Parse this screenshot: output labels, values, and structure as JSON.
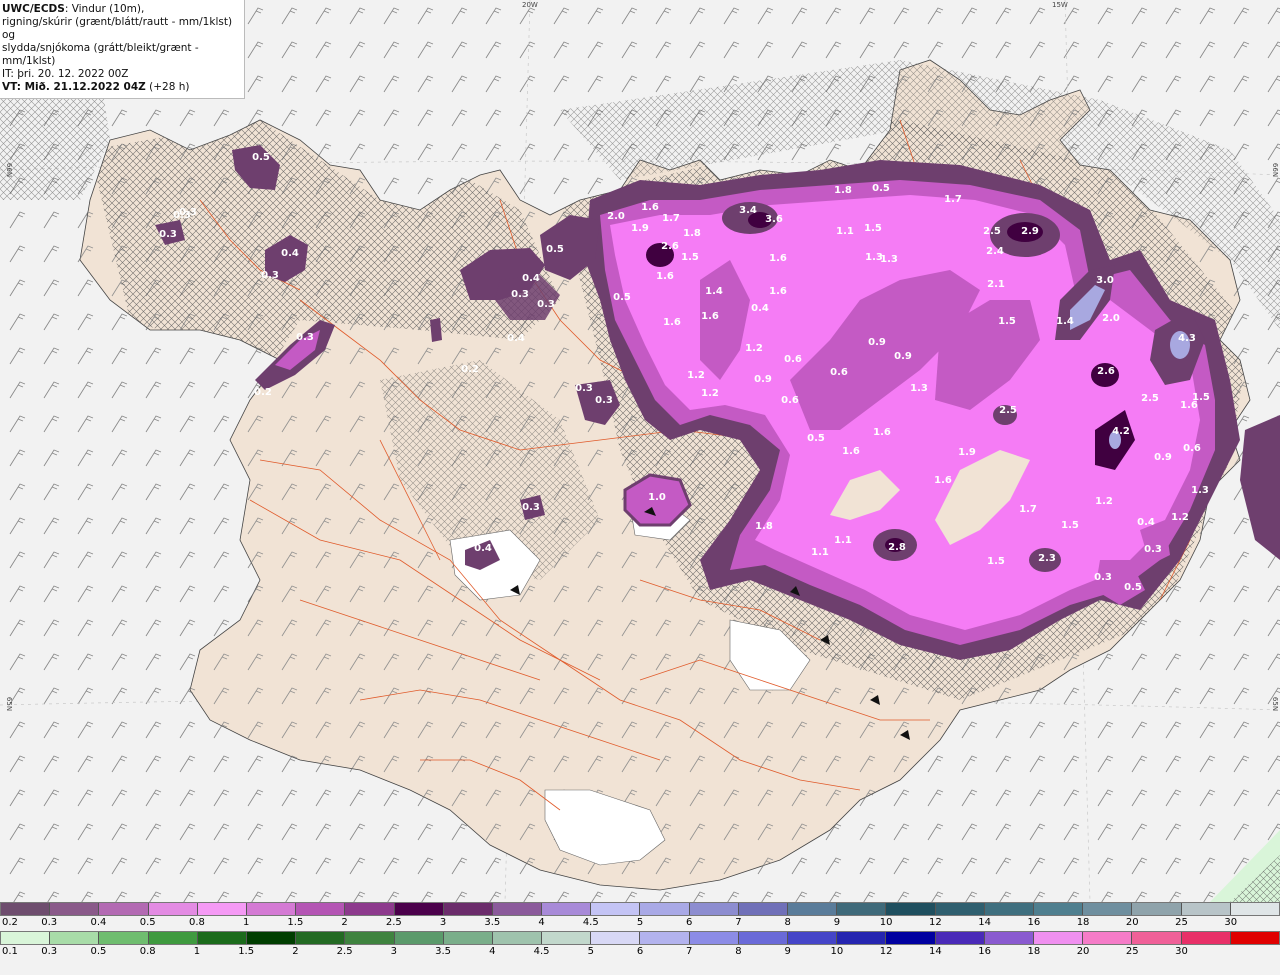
{
  "header": {
    "product": "UWC/ECDS",
    "line1_rest": ": Vindur (10m),",
    "line2": "rigning/skúrir (grænt/blátt/rautt - mm/1klst) og",
    "line3": "slydda/snjókoma (grátt/bleikt/grænt - mm/1klst)",
    "it_line": "IT: þri. 20. 12. 2022 00Z",
    "vt_bold": "VT: Mið. 21.12.2022 04Z",
    "vt_rest": " (+28 h)"
  },
  "coordinates": {
    "top_left": "20W",
    "top_right": "15W",
    "left_upper": "66N",
    "left_lower": "65N",
    "right_upper": "66N",
    "right_lower": "65N"
  },
  "colors": {
    "sea": "#f2f2f2",
    "land": "#f1e3d5",
    "road": "#e05a2a",
    "light_purple": "#e68ae6",
    "mid_purple": "#c45ac4",
    "magenta": "#f57cf5",
    "dark_purple": "#6e3f6e",
    "deep_purple": "#400040",
    "blue_lavender": "#a8a8e0"
  },
  "map_labels": [
    {
      "text": "0.5"
    },
    {
      "text": "0.3"
    },
    {
      "text": "0.4"
    },
    {
      "text": "0.3"
    },
    {
      "text": "0.3"
    },
    {
      "text": "0.2"
    },
    {
      "text": "0.3"
    },
    {
      "text": "0.3"
    },
    {
      "text": "0.3"
    },
    {
      "text": "0.4"
    },
    {
      "text": "0.4"
    },
    {
      "text": "0.3"
    },
    {
      "text": "0.3"
    },
    {
      "text": "0.5"
    },
    {
      "text": "2.0"
    },
    {
      "text": "1.9"
    },
    {
      "text": "1.6"
    },
    {
      "text": "1.7"
    },
    {
      "text": "1.8"
    },
    {
      "text": "2.6"
    },
    {
      "text": "1.5"
    },
    {
      "text": "1.6"
    },
    {
      "text": "1.4"
    },
    {
      "text": "1.6"
    },
    {
      "text": "1.6"
    },
    {
      "text": "0.5"
    },
    {
      "text": "3.4"
    },
    {
      "text": "3.6"
    },
    {
      "text": "1.6"
    },
    {
      "text": "1.8"
    },
    {
      "text": "0.5"
    },
    {
      "text": "1.1"
    },
    {
      "text": "1.5"
    },
    {
      "text": "1.3"
    },
    {
      "text": "1.3"
    },
    {
      "text": "1.7"
    },
    {
      "text": "2.5"
    },
    {
      "text": "2.9"
    },
    {
      "text": "2.4"
    },
    {
      "text": "2.1"
    },
    {
      "text": "1.6"
    },
    {
      "text": "0.4"
    },
    {
      "text": "1.2"
    },
    {
      "text": "0.6"
    },
    {
      "text": "1.2"
    },
    {
      "text": "0.9"
    },
    {
      "text": "1.2"
    },
    {
      "text": "0.6"
    },
    {
      "text": "0.9"
    },
    {
      "text": "0.9"
    },
    {
      "text": "0.6"
    },
    {
      "text": "1.3"
    },
    {
      "text": "1.5"
    },
    {
      "text": "3.0"
    },
    {
      "text": "2.0"
    },
    {
      "text": "1.4"
    },
    {
      "text": "4.3"
    },
    {
      "text": "2.6"
    },
    {
      "text": "2.5"
    },
    {
      "text": "1.6"
    },
    {
      "text": "1.5"
    },
    {
      "text": "2.5"
    },
    {
      "text": "0.5"
    },
    {
      "text": "1.6"
    },
    {
      "text": "1.6"
    },
    {
      "text": "1.9"
    },
    {
      "text": "1.6"
    },
    {
      "text": "4.2"
    },
    {
      "text": "0.9"
    },
    {
      "text": "0.6"
    },
    {
      "text": "1.0"
    },
    {
      "text": "1.3"
    },
    {
      "text": "1.2"
    },
    {
      "text": "1.7"
    },
    {
      "text": "1.5"
    },
    {
      "text": "1.2"
    },
    {
      "text": "0.4"
    },
    {
      "text": "1.8"
    },
    {
      "text": "1.1"
    },
    {
      "text": "1.1"
    },
    {
      "text": "2.8"
    },
    {
      "text": "1.5"
    },
    {
      "text": "2.3"
    },
    {
      "text": "0.3"
    },
    {
      "text": "0.5"
    },
    {
      "text": "0.3"
    },
    {
      "text": "0.4"
    },
    {
      "text": "0.3"
    },
    {
      "text": "0.2"
    },
    {
      "text": "0.3"
    }
  ],
  "scale_snow": {
    "ticks": [
      "0.2",
      "0.3",
      "0.4",
      "0.5",
      "0.8",
      "1",
      "1.5",
      "2",
      "2.5",
      "3",
      "3.5",
      "4",
      "4.5",
      "5",
      "6",
      "7",
      "8",
      "9",
      "10",
      "12",
      "14",
      "16",
      "18",
      "20",
      "25",
      "30"
    ],
    "colors": [
      "#6e4d6e",
      "#8a5a8a",
      "#b36ab3",
      "#e38be3",
      "#f59af5",
      "#d47ad4",
      "#b455b4",
      "#8d3a8d",
      "#4b004b",
      "#6b2c6b",
      "#8b5a9b",
      "#a88ad8",
      "#c4c4f5",
      "#a9a9e6",
      "#8d8dd0",
      "#7070b8",
      "#5a7c9a",
      "#3f6a7a",
      "#1f4f5f",
      "#2f5f6f",
      "#3f6f7f",
      "#4f7f8f",
      "#6f8f9f",
      "#8fa3ab",
      "#b8c4c8",
      "#dfe5e7"
    ]
  },
  "scale_rain": {
    "ticks": [
      "0.1",
      "0.3",
      "0.5",
      "0.8",
      "1",
      "1.5",
      "2",
      "2.5",
      "3",
      "3.5",
      "4",
      "4.5",
      "5",
      "6",
      "7",
      "8",
      "9",
      "10",
      "12",
      "14",
      "16",
      "18",
      "20",
      "25",
      "30"
    ],
    "colors": [
      "#d9f5d9",
      "#a8dca8",
      "#6fbd6f",
      "#3f9a3f",
      "#1b6b1b",
      "#003e00",
      "#236a23",
      "#3f833f",
      "#5b9a6b",
      "#7aae8a",
      "#9fc3ad",
      "#c2d8cc",
      "#d8d8f5",
      "#b3b3ee",
      "#8c8ce6",
      "#6a6ad8",
      "#4545c8",
      "#2525b0",
      "#0000a0",
      "#4a2ab8",
      "#8a5ad0",
      "#f090f0",
      "#f57cc8",
      "#f06098",
      "#e83068",
      "#e00000"
    ]
  }
}
